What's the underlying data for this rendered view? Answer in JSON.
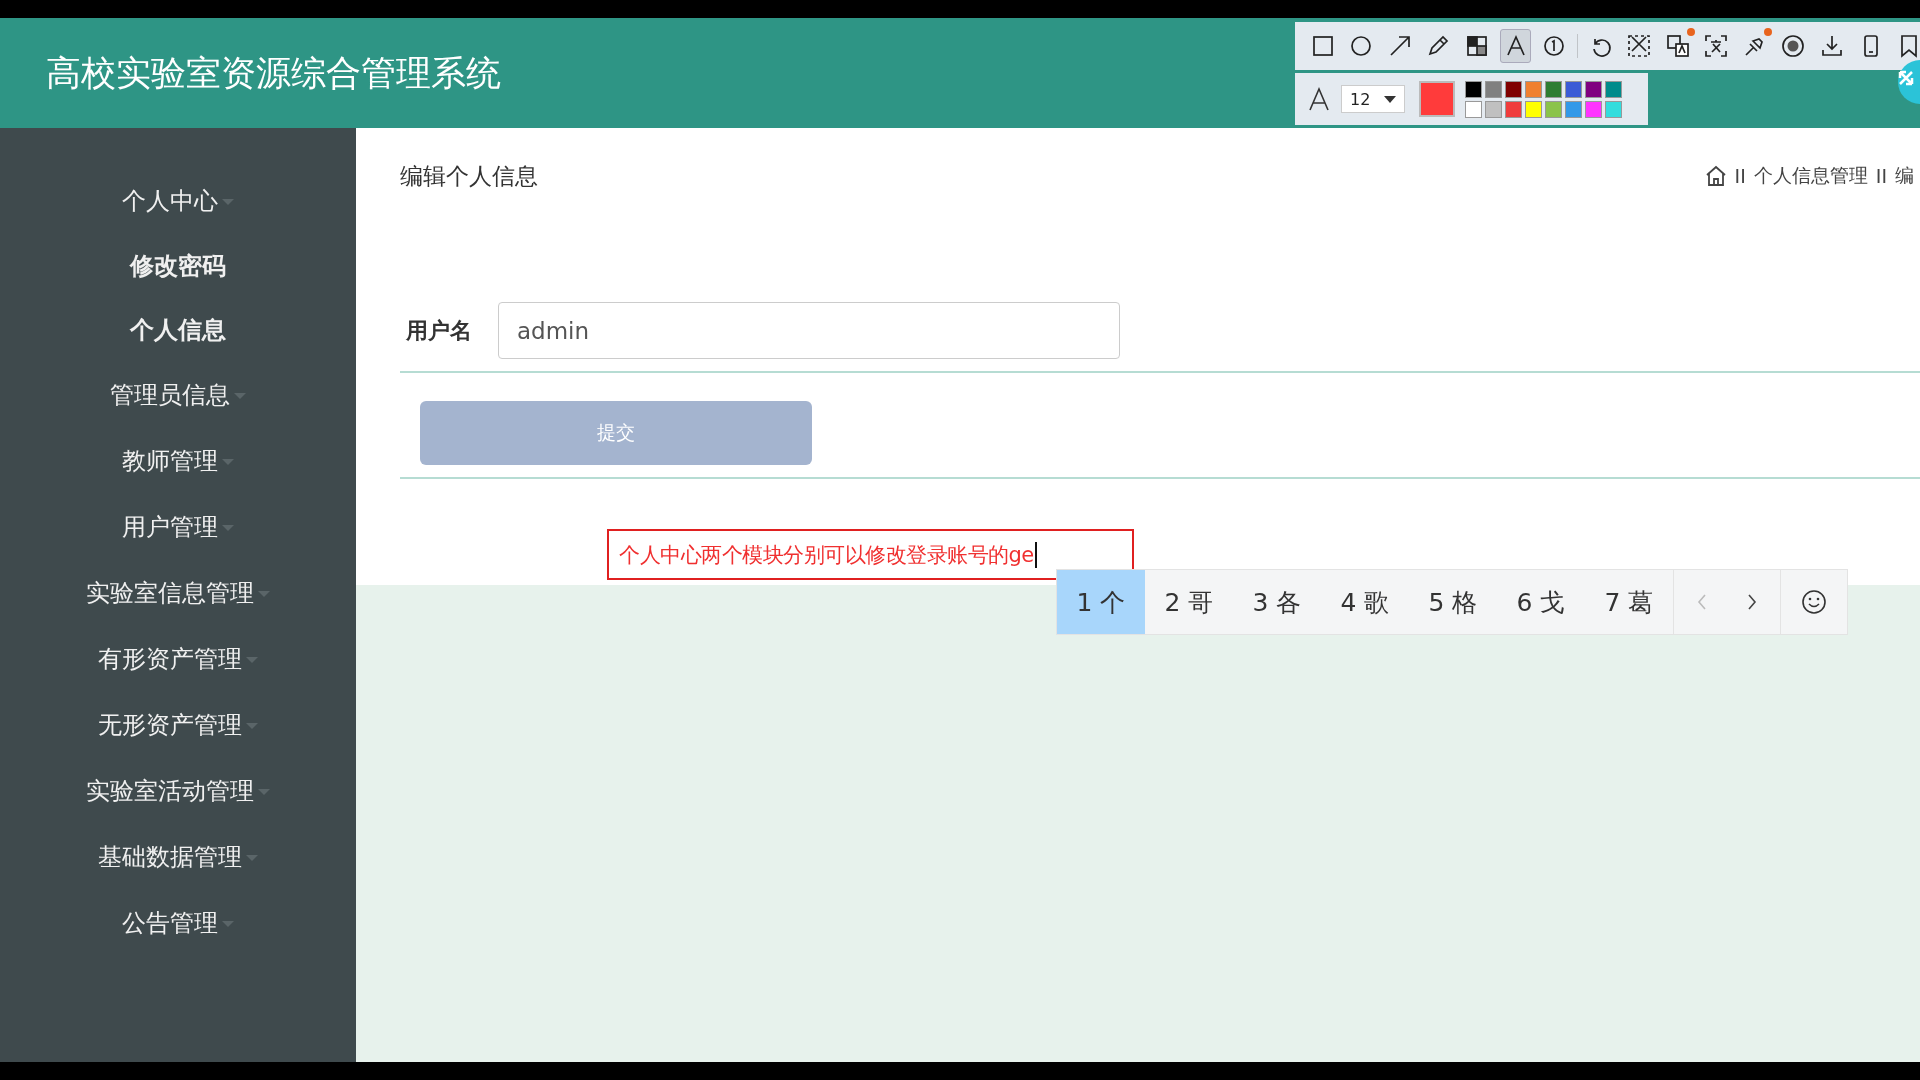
{
  "header": {
    "title": "高校实验室资源综合管理系统"
  },
  "sidebar": {
    "items": [
      {
        "label": "个人中心",
        "children": [
          {
            "label": "修改密码"
          },
          {
            "label": "个人信息"
          }
        ]
      },
      {
        "label": "管理员信息"
      },
      {
        "label": "教师管理"
      },
      {
        "label": "用户管理"
      },
      {
        "label": "实验室信息管理"
      },
      {
        "label": "有形资产管理"
      },
      {
        "label": "无形资产管理"
      },
      {
        "label": "实验室活动管理"
      },
      {
        "label": "基础数据管理"
      },
      {
        "label": "公告管理"
      }
    ]
  },
  "page": {
    "title": "编辑个人信息",
    "breadcrumb": [
      "II",
      "个人信息管理",
      "II",
      "编"
    ]
  },
  "form": {
    "fields": [
      {
        "label": "用户名",
        "value": "admin"
      }
    ],
    "submit": "提交"
  },
  "annotation": {
    "text": "个人中心两个模块分别可以修改登录账号的ge"
  },
  "ime": {
    "candidates": [
      {
        "label": "1 个",
        "selected": true
      },
      {
        "label": "2 哥",
        "selected": false
      },
      {
        "label": "3 各",
        "selected": false
      },
      {
        "label": "4 歌",
        "selected": false
      },
      {
        "label": "5 格",
        "selected": false
      },
      {
        "label": "6 戈",
        "selected": false
      },
      {
        "label": "7 葛",
        "selected": false
      }
    ]
  },
  "screenshot_toolbar": {
    "tools": [
      {
        "kind": "rectangle",
        "selected": false,
        "badge": false
      },
      {
        "kind": "ellipse",
        "selected": false,
        "badge": false
      },
      {
        "kind": "arrow",
        "selected": false,
        "badge": false
      },
      {
        "kind": "pencil",
        "selected": false,
        "badge": false
      },
      {
        "kind": "mosaic",
        "selected": false,
        "badge": false
      },
      {
        "kind": "text",
        "selected": true,
        "badge": false
      },
      {
        "kind": "number",
        "selected": false,
        "badge": false
      },
      {
        "kind": "undo",
        "selected": false,
        "badge": false
      },
      {
        "kind": "cut",
        "selected": false,
        "badge": false
      },
      {
        "kind": "translate",
        "selected": false,
        "badge": true
      },
      {
        "kind": "ocr",
        "selected": false,
        "badge": false
      },
      {
        "kind": "pin",
        "selected": false,
        "badge": true
      },
      {
        "kind": "record",
        "selected": false,
        "badge": false
      },
      {
        "kind": "download",
        "selected": false,
        "badge": false
      },
      {
        "kind": "phone",
        "selected": false,
        "badge": false
      },
      {
        "kind": "bookmark",
        "selected": false,
        "badge": false
      }
    ],
    "font_size": "12",
    "current": {
      "color": "#ff3b3b"
    },
    "palette": [
      {
        "color": "#000000"
      },
      {
        "color": "#808080"
      },
      {
        "color": "#800000"
      },
      {
        "color": "#f08030"
      },
      {
        "color": "#2e7d32"
      },
      {
        "color": "#3b5bd6"
      },
      {
        "color": "#800080"
      },
      {
        "color": "#008b8b"
      },
      {
        "color": "#ffffff"
      },
      {
        "color": "#c0c0c0"
      },
      {
        "color": "#f03c3c"
      },
      {
        "color": "#ffff00"
      },
      {
        "color": "#8bc34a"
      },
      {
        "color": "#3399e8"
      },
      {
        "color": "#ff33ff"
      },
      {
        "color": "#33dddd"
      }
    ]
  }
}
